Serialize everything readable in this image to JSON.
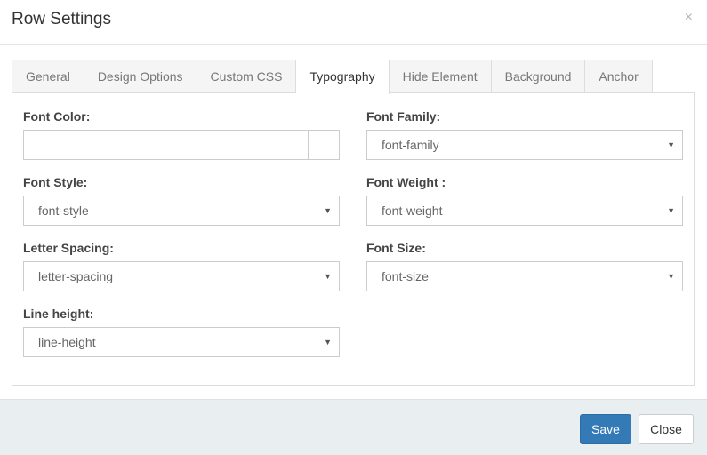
{
  "dialog": {
    "title": "Row Settings",
    "close_glyph": "×"
  },
  "tabs": [
    {
      "label": "General"
    },
    {
      "label": "Design Options"
    },
    {
      "label": "Custom CSS"
    },
    {
      "label": "Typography",
      "active": true
    },
    {
      "label": "Hide Element"
    },
    {
      "label": "Background"
    },
    {
      "label": "Anchor"
    }
  ],
  "form": {
    "font_color": {
      "label": "Font Color:",
      "value": ""
    },
    "font_family": {
      "label": "Font Family:",
      "value": "font-family"
    },
    "font_style": {
      "label": "Font Style:",
      "value": "font-style"
    },
    "font_weight": {
      "label": "Font Weight :",
      "value": "font-weight"
    },
    "letter_spacing": {
      "label": "Letter Spacing:",
      "value": "letter-spacing"
    },
    "font_size": {
      "label": "Font Size:",
      "value": "font-size"
    },
    "line_height": {
      "label": "Line height:",
      "value": "line-height"
    }
  },
  "footer": {
    "save_label": "Save",
    "close_label": "Close"
  },
  "colors": {
    "primary": "#337ab7",
    "footer_bg": "#e9eef0",
    "border": "#dddddd"
  },
  "icons": {
    "dropdown": "caret-down-icon",
    "close": "close-icon"
  }
}
